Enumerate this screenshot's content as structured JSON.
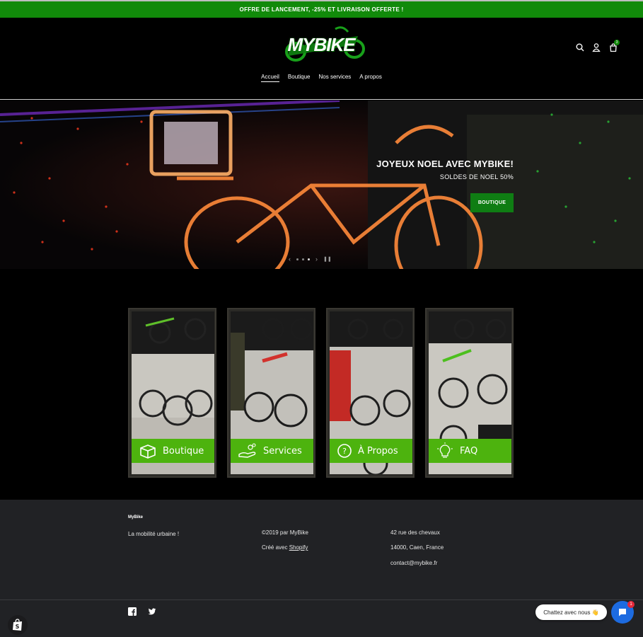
{
  "announcement": "OFFRE DE LANCEMENT, -25% ET LIVRAISON OFFERTE !",
  "brand": {
    "logo_text": "MYBIKE",
    "accent": "#118a0a"
  },
  "nav": [
    {
      "label": "Accueil",
      "active": true
    },
    {
      "label": "Boutique"
    },
    {
      "label": "Nos services"
    },
    {
      "label": "A propos"
    }
  ],
  "header_icons": {
    "search": "search-icon",
    "account": "user-icon",
    "cart": "cart-icon",
    "cart_count": "3"
  },
  "hero": {
    "title": "JOYEUX NOEL AVEC MYBIKE!",
    "subtitle": "SOLDES DE NOEL 50%",
    "button": "BOUTIQUE",
    "slides": 3,
    "active_slide": 3
  },
  "tiles": [
    {
      "label": "Boutique",
      "icon": "box-icon"
    },
    {
      "label": "Services",
      "icon": "hand-coins-icon"
    },
    {
      "label": "À Propos",
      "icon": "question-icon"
    },
    {
      "label": "FAQ",
      "icon": "lightbulb-icon"
    }
  ],
  "footer": {
    "brand": "MyBike",
    "tagline": "La mobilité urbaine !",
    "copyright": "©2019 par MyBike",
    "created_prefix": "Créé avec ",
    "created_link": "Shopify",
    "address_line1": "42 rue des chevaux",
    "address_line2": "14000, Caen, France",
    "email": "contact@mybike.fr"
  },
  "chat": {
    "label": "Chattez avec nous 👋",
    "badge": "1"
  }
}
